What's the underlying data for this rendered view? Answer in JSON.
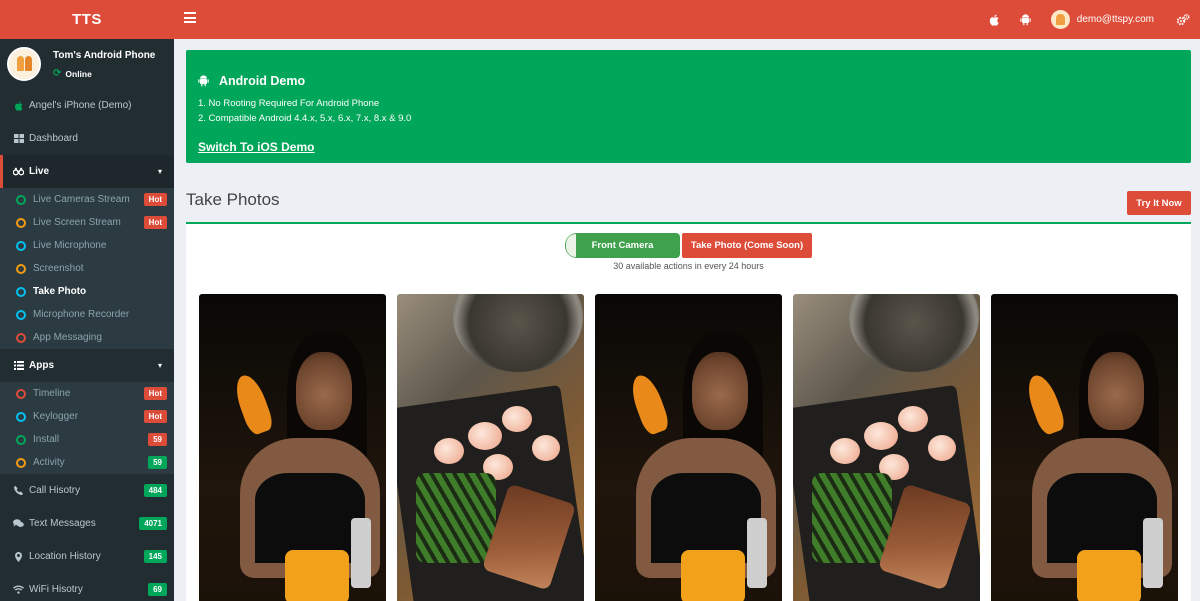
{
  "header": {
    "logo": "TTS",
    "user_email": "demo@ttspy.com",
    "icons": [
      "menu-icon",
      "apple-icon",
      "android-icon",
      "cogs-icon"
    ],
    "colors": {
      "header": "#dd4b39",
      "sidebar": "#222d32",
      "success": "#00a65a",
      "danger": "#dd4b39"
    }
  },
  "sidebar": {
    "profile_name": "Tom's Android Phone",
    "profile_status": "Online",
    "alt_device": "Angel's iPhone (Demo)",
    "dashboard": "Dashboard",
    "live": {
      "label": "Live",
      "items": [
        {
          "label": "Live Cameras Stream",
          "badge": "Hot",
          "color": "#00a65a"
        },
        {
          "label": "Live Screen Stream",
          "badge": "Hot",
          "color": "#f39c12"
        },
        {
          "label": "Live Microphone",
          "badge": "",
          "color": "#00c0ef"
        },
        {
          "label": "Screenshot",
          "badge": "",
          "color": "#f39c12"
        },
        {
          "label": "Take Photo",
          "badge": "",
          "color": "#00c0ef"
        },
        {
          "label": "Microphone Recorder",
          "badge": "",
          "color": "#00c0ef"
        },
        {
          "label": "App Messaging",
          "badge": "",
          "color": "#dd4b39"
        }
      ]
    },
    "apps": {
      "label": "Apps",
      "items": [
        {
          "label": "Timeline",
          "badge": "Hot",
          "color": "#dd4b39"
        },
        {
          "label": "Keylogger",
          "badge": "Hot",
          "color": "#00c0ef"
        },
        {
          "label": "Install",
          "badge": "59",
          "color": "#00a65a"
        },
        {
          "label": "Activity",
          "badge": "59",
          "color": "#f39c12"
        }
      ]
    },
    "call_history": {
      "label": "Call Hisotry",
      "badge": "484"
    },
    "text_messages": {
      "label": "Text Messages",
      "badge": "4071"
    },
    "location_history": {
      "label": "Location History",
      "badge": "145"
    },
    "wifi_history": {
      "label": "WiFi Hisotry",
      "badge": "69"
    }
  },
  "callout": {
    "title": "Android Demo",
    "line1": "1. No Rooting Required For Android Phone",
    "line2": "2. Compatible Android 4.4.x, 5.x, 6.x, 7.x, 8.x & 9.0",
    "switch_link": "Switch To iOS Demo"
  },
  "main": {
    "title": "Take Photos",
    "try_button": "Try It Now",
    "front_camera": "Front Camera",
    "take_photo": "Take Photo (Come Soon)",
    "actions_note": "30 available actions in every 24 hours"
  }
}
